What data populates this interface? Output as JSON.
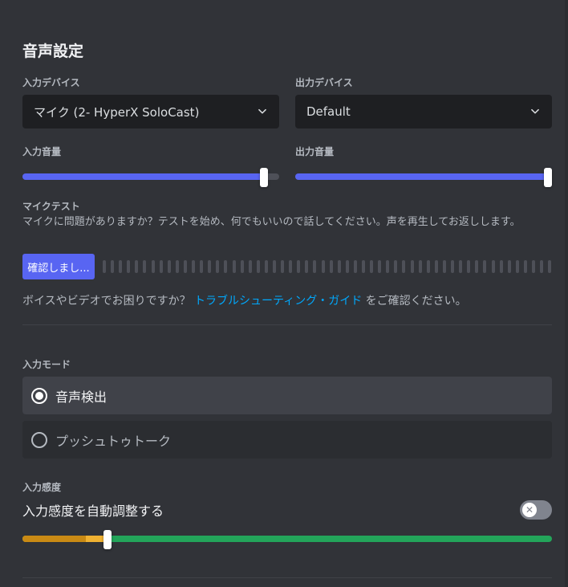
{
  "title": "音声設定",
  "input_device": {
    "label": "入力デバイス",
    "value": "マイク (2- HyperX SoloCast)"
  },
  "output_device": {
    "label": "出力デバイス",
    "value": "Default"
  },
  "input_volume": {
    "label": "入力音量",
    "level": 0.94
  },
  "output_volume": {
    "label": "出力音量",
    "level": 1.0
  },
  "mic_test": {
    "label": "マイクテスト",
    "description": "マイクに問題がありますか？テストを始め、何でもいいので話してください。声を再生してお返しします。",
    "button_label": "確認しまし...",
    "meter_bars": 56
  },
  "help": {
    "prefix": "ボイスやビデオでお困りですか？",
    "link_text": "トラブルシューティング・ガイド",
    "suffix": "をご確認ください。"
  },
  "input_mode": {
    "label": "入力モード",
    "options": [
      {
        "label": "音声検出",
        "selected": true
      },
      {
        "label": "プッシュトゥトーク",
        "selected": false
      }
    ]
  },
  "input_sensitivity": {
    "label": "入力感度",
    "auto_label": "入力感度を自動調整する",
    "auto_enabled": false,
    "threshold": 0.16,
    "level": 0.12
  },
  "colors": {
    "accent": "#5865f2",
    "link": "#00a8fc",
    "green": "#23a55a",
    "orange": "#f0b232"
  }
}
